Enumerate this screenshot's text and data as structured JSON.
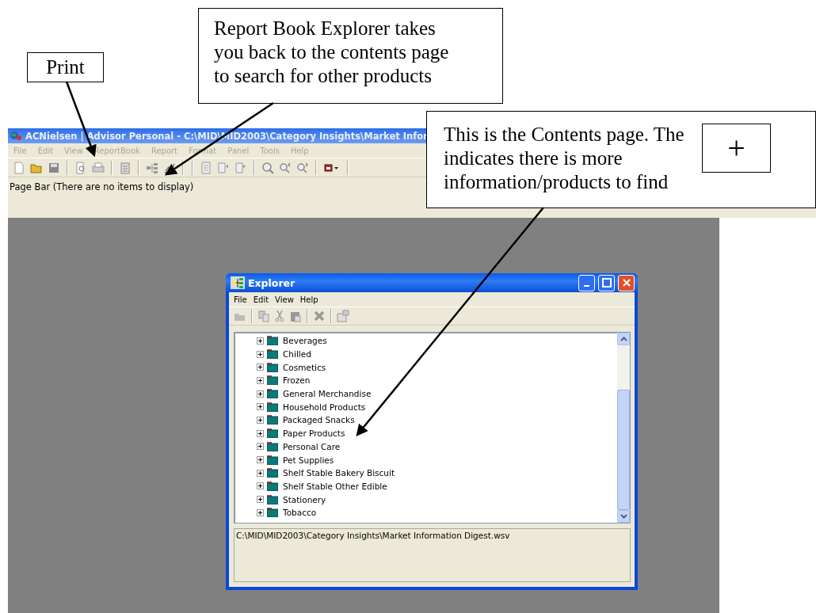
{
  "app": {
    "title": "ACNielsen | Advisor Personal - C:\\MID\\MID2003\\Category Insights\\Market Infor",
    "menu": [
      {
        "label": "File",
        "disabled": true
      },
      {
        "label": "Edit",
        "disabled": true
      },
      {
        "label": "View",
        "disabled": true
      },
      {
        "label": "ReportBook",
        "disabled": true
      },
      {
        "label": "Report",
        "disabled": true
      },
      {
        "label": "Format",
        "disabled": true
      },
      {
        "label": "Panel",
        "disabled": true
      },
      {
        "label": "Tools",
        "disabled": true
      },
      {
        "label": "Help",
        "disabled": true
      }
    ],
    "page_bar": "Page Bar  (There are no items to display)"
  },
  "explorer": {
    "title": "Explorer",
    "menu": [
      {
        "label": "File"
      },
      {
        "label": "Edit"
      },
      {
        "label": "View"
      },
      {
        "label": "Help"
      }
    ],
    "tree": [
      {
        "label": "Beverages",
        "expanded": false
      },
      {
        "label": "Chilled",
        "expanded": false
      },
      {
        "label": "Cosmetics",
        "expanded": false
      },
      {
        "label": "Frozen",
        "expanded": false
      },
      {
        "label": "General Merchandise",
        "expanded": false
      },
      {
        "label": "Household Products",
        "expanded": false
      },
      {
        "label": "Packaged Snacks",
        "expanded": false
      },
      {
        "label": "Paper Products",
        "expanded": false
      },
      {
        "label": "Personal Care",
        "expanded": false
      },
      {
        "label": "Pet Supplies",
        "expanded": false
      },
      {
        "label": "Shelf Stable Bakery Biscuit",
        "expanded": false
      },
      {
        "label": "Shelf Stable Other Edible",
        "expanded": false
      },
      {
        "label": "Stationery",
        "expanded": false
      },
      {
        "label": "Tobacco",
        "expanded": false
      }
    ],
    "path": "C:\\MID\\MID2003\\Category Insights\\Market Information Digest.wsv"
  },
  "callouts": [
    {
      "text": "Print"
    },
    {
      "text": "Report Book Explorer takes you back to the contents page to search for other products"
    },
    {
      "text": "This is the Contents page. The indicates there is more information/products to find",
      "symbol": "+"
    }
  ]
}
